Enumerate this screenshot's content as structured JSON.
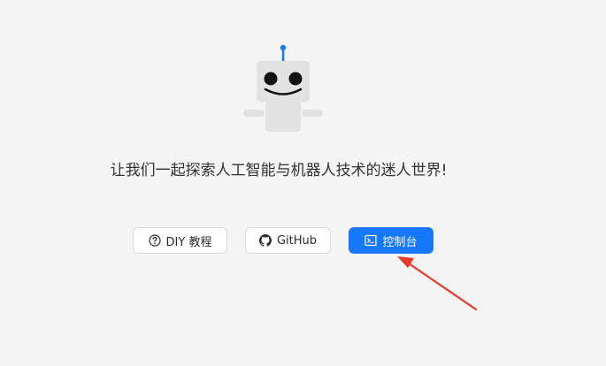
{
  "hero": {
    "mascot_icon": "robot-icon",
    "tagline": "让我们一起探索人工智能与机器人技术的迷人世界!"
  },
  "actions": {
    "diy": {
      "label": "DIY 教程",
      "icon": "question-circle-icon"
    },
    "github": {
      "label": "GitHub",
      "icon": "github-icon"
    },
    "console": {
      "label": "控制台",
      "icon": "terminal-icon"
    }
  },
  "colors": {
    "primary": "#1677ff",
    "background": "#f4f4f4",
    "annotation": "#e8392d"
  }
}
